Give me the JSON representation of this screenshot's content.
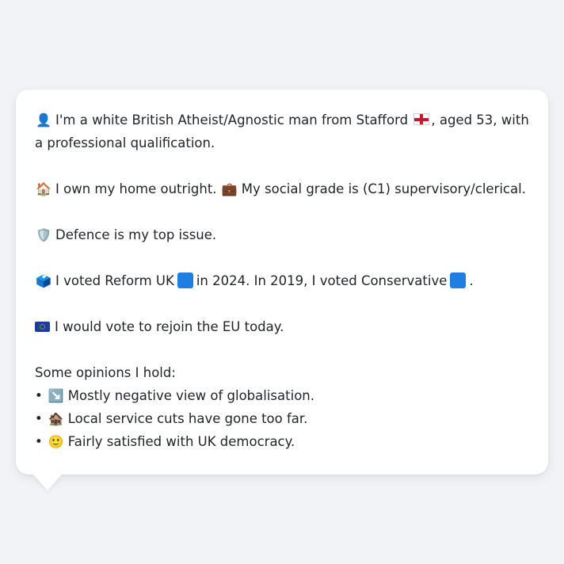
{
  "profile": {
    "intro": {
      "icon": "person-silhouette-icon",
      "text_before_flag": "I'm a white British Atheist/Agnostic man from Stafford",
      "flag": "england-flag-icon",
      "text_after_flag": ", aged 53, with a professional qualification."
    },
    "home": {
      "icon": "house-icon",
      "text_home": "I own my home outright.",
      "briefcase_icon": "briefcase-icon",
      "text_grade": "My social grade is (C1) supervisory/clerical."
    },
    "issue": {
      "icon": "shield-icon",
      "text": "Defence is my top issue."
    },
    "vote": {
      "icon": "ballot-box-icon",
      "text_part1": "I voted Reform UK",
      "reform_color": "#1e7fe0",
      "text_part2": "in 2024. In 2019, I voted Conservative",
      "conservative_color": "#1e7fe0",
      "text_part3": "."
    },
    "eu": {
      "icon": "eu-flag-icon",
      "text": "I would vote to rejoin the EU today."
    },
    "opinions": {
      "heading": "Some opinions I hold:",
      "bullet": "•",
      "items": [
        {
          "icon": "down-right-arrow-icon",
          "emoji": "↘️",
          "text": "Mostly negative view of globalisation."
        },
        {
          "icon": "derelict-house-icon",
          "emoji": "🏚️",
          "text": "Local service cuts have gone too far."
        },
        {
          "icon": "slightly-smiling-face-icon",
          "emoji": "🙂",
          "text": "Fairly satisfied with UK democracy."
        }
      ]
    }
  }
}
